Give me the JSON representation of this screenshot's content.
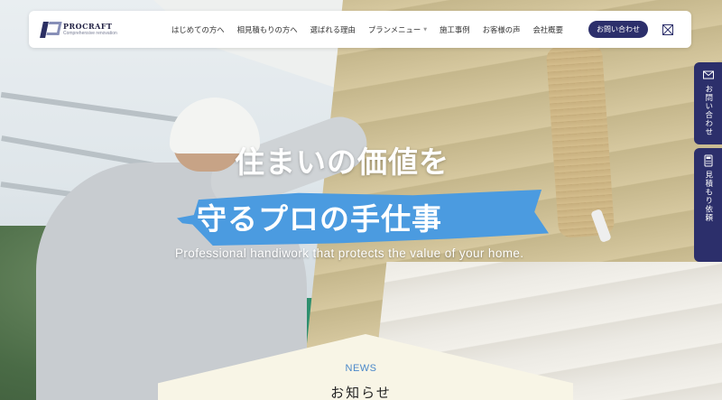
{
  "brand": {
    "name": "PROCRAFT",
    "tagline": "Comprehensive renovation",
    "accent": "#2c2f6b",
    "highlight": "#4b9be0"
  },
  "nav": {
    "items": [
      {
        "label": "はじめての方へ"
      },
      {
        "label": "相見積もりの方へ"
      },
      {
        "label": "選ばれる理由"
      },
      {
        "label": "プランメニュー",
        "has_dropdown": true
      },
      {
        "label": "施工事例"
      },
      {
        "label": "お客様の声"
      },
      {
        "label": "会社概要"
      }
    ],
    "contact_label": "お問い合わせ",
    "menu_icon": "close-x-icon"
  },
  "side_tabs": {
    "contact": {
      "label": "お問い合わせ",
      "icon": "mail-icon"
    },
    "estimate": {
      "label": "見積もり依頼",
      "icon": "calculator-icon"
    }
  },
  "hero": {
    "headline_line1": "住まいの価値を",
    "headline_line2": "守るプロの手仕事",
    "subline": "Professional handiwork that protects the value of your home."
  },
  "news": {
    "label_en": "NEWS",
    "label_jp": "お知らせ"
  }
}
